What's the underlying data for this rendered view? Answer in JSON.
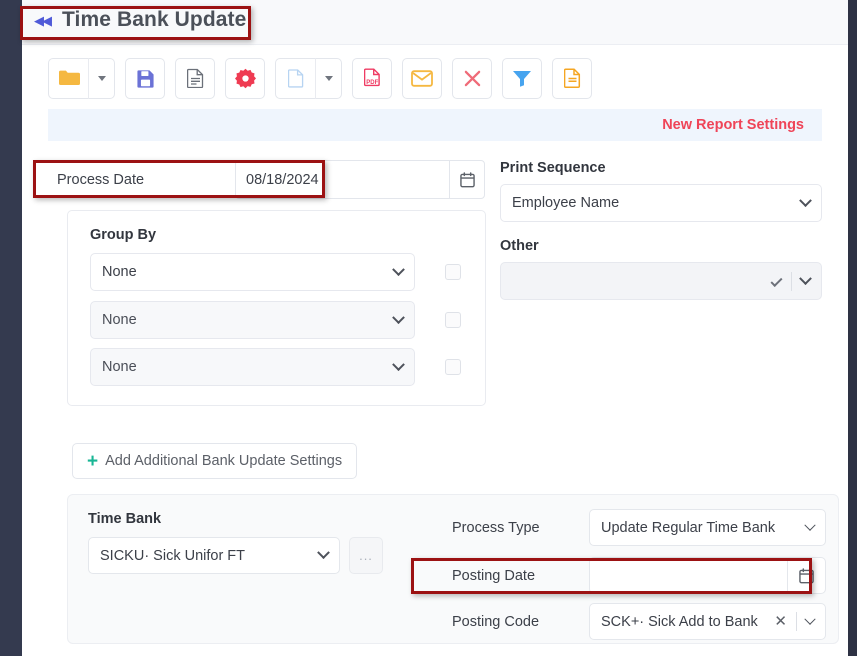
{
  "window": {
    "title": "Time Bank Update",
    "collapse_icon": "double-left-chevron",
    "accent_red": "#9c1213",
    "banner_text_color": "#ef4458"
  },
  "toolbar": {
    "buttons": [
      {
        "name": "open-folder",
        "icon": "folder-icon",
        "color": "#f5b841",
        "has_caret": true
      },
      {
        "name": "save",
        "icon": "save-floppy-icon",
        "color": "#6b72d6"
      },
      {
        "name": "report",
        "icon": "document-lines-icon",
        "color": "#6b7079"
      },
      {
        "name": "settings",
        "icon": "gear-icon",
        "color": "#ef3b52"
      },
      {
        "name": "new-page",
        "icon": "blank-page-icon",
        "color": "#b7d4f2",
        "has_caret": true
      },
      {
        "name": "export-pdf",
        "icon": "pdf-icon",
        "color": "#ef3b63"
      },
      {
        "name": "email",
        "icon": "envelope-icon",
        "color": "#f5b841"
      },
      {
        "name": "delete",
        "icon": "x-close-icon",
        "color": "#ef6b78"
      },
      {
        "name": "filter",
        "icon": "funnel-filter-icon",
        "color": "#47a4ef"
      },
      {
        "name": "notes",
        "icon": "document-note-icon",
        "color": "#f5a623"
      }
    ]
  },
  "banner": {
    "label": "New Report Settings"
  },
  "process_date": {
    "label": "Process Date",
    "value": "08/18/2024",
    "calendar_icon": "calendar-icon"
  },
  "group_by": {
    "title": "Group By",
    "rows": [
      {
        "value": "None",
        "disabled": false,
        "checked": false
      },
      {
        "value": "None",
        "disabled": true,
        "checked": false
      },
      {
        "value": "None",
        "disabled": true,
        "checked": false
      }
    ]
  },
  "print_sequence": {
    "label": "Print Sequence",
    "value": "Employee Name"
  },
  "other": {
    "label": "Other",
    "value": "",
    "disabled": true,
    "check_icon": "check-icon",
    "chevron_icon": "chevron-down-icon"
  },
  "add_settings_button": {
    "label": "Add Additional Bank Update Settings",
    "plus_icon": "plus-icon",
    "plus_color": "#19b695"
  },
  "bank_update": {
    "time_bank_label": "Time Bank",
    "time_bank_value": "SICKU· Sick Unifor FT",
    "ellipsis_button": "...",
    "process_type_label": "Process Type",
    "process_type_value": "Update Regular Time Bank",
    "posting_date_label": "Posting Date",
    "posting_date_value": "",
    "posting_code_label": "Posting Code",
    "posting_code_value": "SCK+· Sick Add to Bank",
    "clear_icon": "x-clear-icon"
  }
}
